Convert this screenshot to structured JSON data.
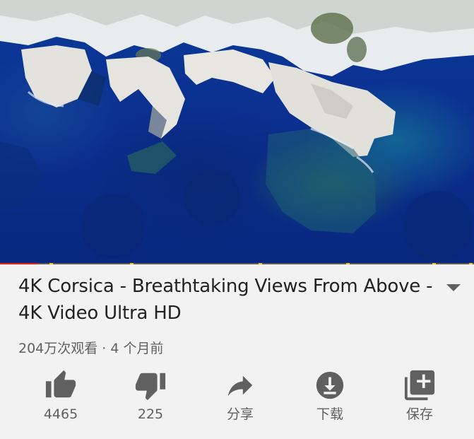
{
  "video": {
    "title": "4K Corsica - Breathtaking Views From Above - 4K Video Ultra HD",
    "meta": "204万次观看 · 4 个月前",
    "progress_fraction": 0.08
  },
  "actions": [
    {
      "icon": "thumbs-up-icon",
      "label": "4465"
    },
    {
      "icon": "thumbs-down-icon",
      "label": "225"
    },
    {
      "icon": "share-icon",
      "label": "分享"
    },
    {
      "icon": "download-icon",
      "label": "下载"
    },
    {
      "icon": "save-to-playlist-icon",
      "label": "保存"
    }
  ],
  "colors": {
    "progress": "#e62117",
    "chapter_marker": "#f2c230",
    "icon": "#606060",
    "background": "#f2f2f2"
  }
}
